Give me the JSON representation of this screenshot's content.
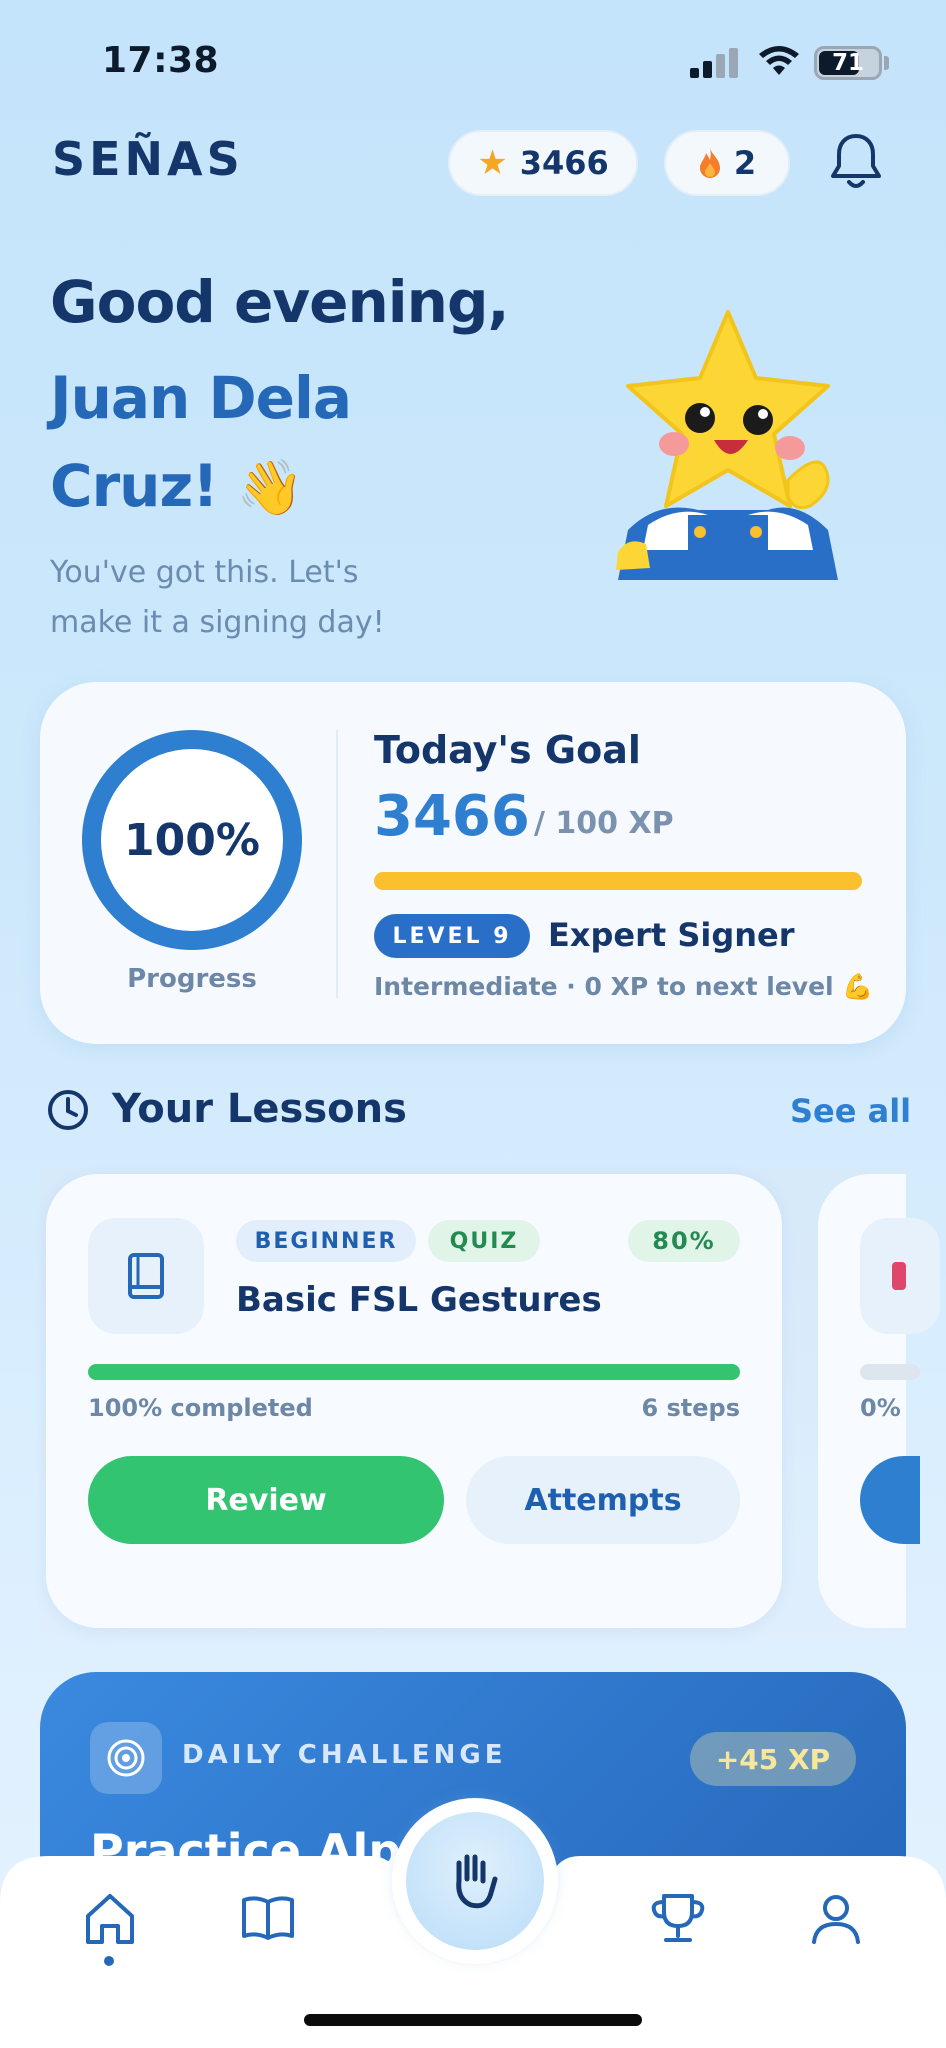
{
  "status_bar": {
    "time": "17:38",
    "battery": "71"
  },
  "header": {
    "brand": "SEÑAS",
    "stars": "3466",
    "streak": "2"
  },
  "greeting": {
    "line1": "Good evening,",
    "name": "Juan Dela Cruz!",
    "wave": "👋",
    "subtext": "You've got this. Let's make it a signing day!"
  },
  "goal": {
    "progress_percent": "100%",
    "progress_label": "Progress",
    "title": "Today's Goal",
    "xp": "3466",
    "xp_target": "/ 100 XP",
    "bar_fill": 1.0,
    "level_badge": "LEVEL 9",
    "level_title": "Expert Signer",
    "level_sub": "Intermediate · 0 XP to next level 💪"
  },
  "lessons": {
    "title": "Your Lessons",
    "see_all": "See all",
    "cards": [
      {
        "level": "BEGINNER",
        "type": "QUIZ",
        "score": "80%",
        "title": "Basic FSL Gestures",
        "progress": 1.0,
        "completed": "100% completed",
        "steps": "6 steps",
        "review_label": "Review",
        "attempts_label": "Attempts"
      },
      {
        "completed": "0%",
        "progress": 0
      }
    ]
  },
  "daily_challenge": {
    "label": "DAILY CHALLENGE",
    "xp": "+45 XP",
    "title": "Practice Alp"
  },
  "colors": {
    "brand_dark": "#14366a",
    "accent_blue": "#2f7fd0",
    "success_green": "#34c46f",
    "goal_yellow": "#fbc02d"
  },
  "nav": {
    "items": [
      "home-icon",
      "book-open-icon",
      "hand-icon",
      "trophy-icon",
      "user-icon"
    ]
  }
}
